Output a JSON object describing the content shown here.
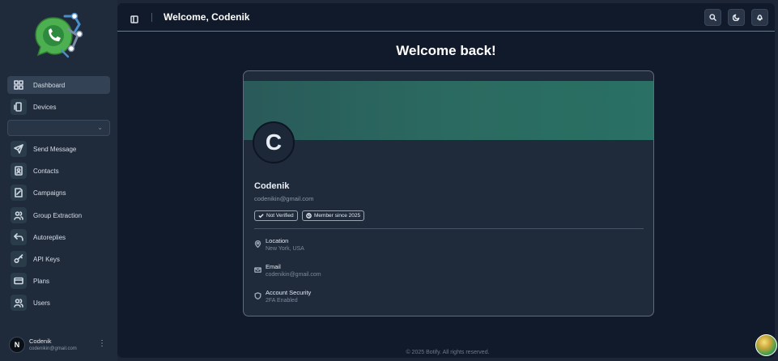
{
  "sidebar": {
    "logo_icon": "whatsapp-gear-logo",
    "items": [
      {
        "label": "Dashboard",
        "icon": "grid-icon"
      },
      {
        "label": "Devices",
        "icon": "device-icon"
      },
      {
        "label": "Send Message",
        "icon": "send-icon"
      },
      {
        "label": "Contacts",
        "icon": "contacts-icon"
      },
      {
        "label": "Campaigns",
        "icon": "campaigns-icon"
      },
      {
        "label": "Group Extraction",
        "icon": "group-icon"
      },
      {
        "label": "Autoreplies",
        "icon": "reply-icon"
      },
      {
        "label": "API Keys",
        "icon": "key-icon"
      },
      {
        "label": "Plans",
        "icon": "card-icon"
      },
      {
        "label": "Users",
        "icon": "users-icon"
      }
    ],
    "device_select": {
      "value": ""
    },
    "user": {
      "initial": "N",
      "name": "Codenik",
      "email": "codenikin@gmail.com"
    }
  },
  "header": {
    "title": "Welcome, Codenik"
  },
  "main": {
    "welcome": "Welcome back!",
    "profile": {
      "avatar_letter": "C",
      "name": "Codenik",
      "email": "codenikin@gmail.com",
      "badges": [
        "Not Verified",
        "Member since 2025"
      ],
      "info": [
        {
          "label": "Location",
          "value": "New York, USA",
          "icon": "pin-icon"
        },
        {
          "label": "Email",
          "value": "codenikin@gmail.com",
          "icon": "mail-icon"
        },
        {
          "label": "Account Security",
          "value": "2FA Enabled",
          "icon": "shield-icon"
        }
      ]
    }
  },
  "footer": {
    "text": "© 2025 Botify. All rights reserved."
  },
  "colors": {
    "accent": "#2a6a60",
    "background": "#111a2a",
    "sidebar": "#1f2a3a"
  }
}
